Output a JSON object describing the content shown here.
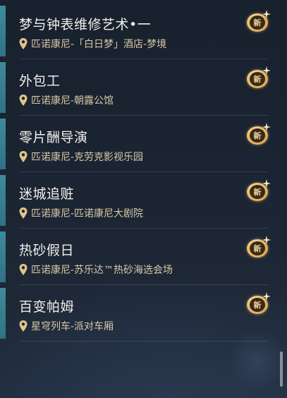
{
  "colors": {
    "accent_bar": "#3f8b9a",
    "location_text": "#d9c9a6",
    "badge_gold": "#e6b869"
  },
  "items": [
    {
      "title": "梦与钟表维修艺术•一",
      "location": "匹诺康尼-「白日梦」酒店-梦境",
      "badge": "新",
      "icon": "map-pin-icon"
    },
    {
      "title": "外包工",
      "location": "匹诺康尼-朝露公馆",
      "badge": "新",
      "icon": "map-pin-icon"
    },
    {
      "title": "零片酬导演",
      "location": "匹诺康尼-克劳克影视乐园",
      "badge": "新",
      "icon": "map-pin-icon"
    },
    {
      "title": "迷城追赃",
      "location": "匹诺康尼-匹诺康尼大剧院",
      "badge": "新",
      "icon": "map-pin-icon"
    },
    {
      "title": "热砂假日",
      "location": "匹诺康尼-苏乐达™热砂海选会场",
      "badge": "新",
      "icon": "map-pin-icon"
    },
    {
      "title": "百变帕姆",
      "location": "星穹列车-派对车厢",
      "badge": "新",
      "icon": "map-pin-icon"
    }
  ]
}
